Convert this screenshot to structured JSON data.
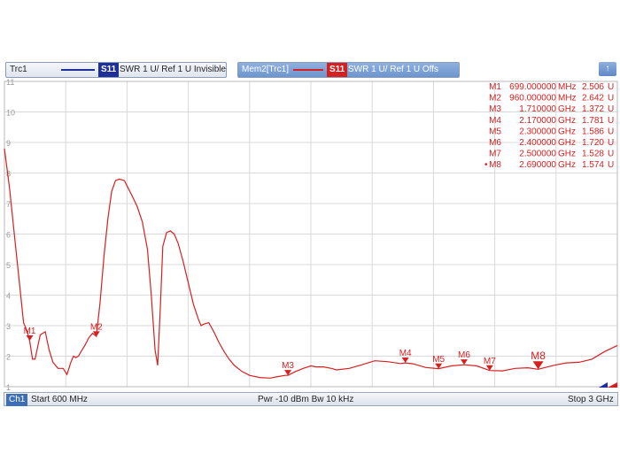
{
  "header": {
    "trace1": {
      "name": "Trc1",
      "param": "S11",
      "desc": "SWR  1 U/ Ref 1 U  Invisible",
      "color": "#1f2f9a"
    },
    "trace2": {
      "name": "Mem2[Trc1]",
      "param": "S11",
      "desc": "SWR  1 U/ Ref 1 U  Offs",
      "color": "#d62020"
    },
    "button_glyph": "↑"
  },
  "footer": {
    "channel": "Ch1",
    "start": "Start  600 MHz",
    "center": "Pwr  -10 dBm  Bw  10 kHz",
    "stop": "Stop  3 GHz"
  },
  "marker_table": [
    {
      "label": "M1",
      "freq": "699.000000",
      "unit": "MHz",
      "value": "2.506",
      "vunit": "U",
      "active": false
    },
    {
      "label": "M2",
      "freq": "960.000000",
      "unit": "MHz",
      "value": "2.642",
      "vunit": "U",
      "active": false
    },
    {
      "label": "M3",
      "freq": "1.710000",
      "unit": "GHz",
      "value": "1.372",
      "vunit": "U",
      "active": false
    },
    {
      "label": "M4",
      "freq": "2.170000",
      "unit": "GHz",
      "value": "1.781",
      "vunit": "U",
      "active": false
    },
    {
      "label": "M5",
      "freq": "2.300000",
      "unit": "GHz",
      "value": "1.586",
      "vunit": "U",
      "active": false
    },
    {
      "label": "M6",
      "freq": "2.400000",
      "unit": "GHz",
      "value": "1.720",
      "vunit": "U",
      "active": false
    },
    {
      "label": "M7",
      "freq": "2.500000",
      "unit": "GHz",
      "value": "1.528",
      "vunit": "U",
      "active": false
    },
    {
      "label": "M8",
      "freq": "2.690000",
      "unit": "GHz",
      "value": "1.574",
      "vunit": "U",
      "active": true
    }
  ],
  "chart_data": {
    "type": "line",
    "title": "",
    "xlabel": "",
    "ylabel": "",
    "xlim": [
      600,
      3000
    ],
    "ylim": [
      1,
      11
    ],
    "x_unit": "MHz",
    "grid": true,
    "y_ticks": [
      "11",
      "10",
      "9",
      "8",
      "7",
      "6",
      "5",
      "4",
      "3",
      "2",
      "1"
    ],
    "series": [
      {
        "color": "#d62020",
        "x": [
          600,
          620,
          640,
          660,
          675,
          690,
          699,
          710,
          720,
          740,
          760,
          775,
          790,
          810,
          830,
          845,
          860,
          870,
          880,
          890,
          900,
          915,
          930,
          945,
          960,
          975,
          990,
          1005,
          1020,
          1035,
          1050,
          1070,
          1085,
          1100,
          1120,
          1140,
          1160,
          1175,
          1190,
          1200,
          1210,
          1220,
          1235,
          1250,
          1265,
          1280,
          1300,
          1320,
          1340,
          1360,
          1370,
          1380,
          1400,
          1420,
          1440,
          1460,
          1480,
          1500,
          1530,
          1560,
          1600,
          1640,
          1670,
          1700,
          1710,
          1740,
          1770,
          1800,
          1820,
          1850,
          1880,
          1900,
          1950,
          2000,
          2050,
          2100,
          2150,
          2170,
          2200,
          2250,
          2300,
          2350,
          2400,
          2450,
          2500,
          2550,
          2600,
          2650,
          2690,
          2750,
          2800,
          2850,
          2900,
          2950,
          3000
        ],
        "y": [
          8.8,
          7.5,
          5.9,
          4.3,
          3.1,
          2.8,
          2.5,
          1.9,
          1.9,
          2.7,
          2.8,
          2.2,
          1.8,
          1.6,
          1.6,
          1.4,
          1.8,
          2.0,
          1.95,
          2.0,
          2.15,
          2.35,
          2.6,
          2.75,
          2.65,
          3.8,
          5.3,
          6.5,
          7.4,
          7.75,
          7.8,
          7.75,
          7.5,
          7.25,
          6.9,
          6.4,
          5.5,
          4.0,
          2.2,
          1.7,
          3.5,
          5.6,
          6.05,
          6.1,
          6.0,
          5.7,
          5.1,
          4.4,
          3.7,
          3.2,
          3.0,
          3.05,
          3.1,
          2.8,
          2.45,
          2.15,
          1.9,
          1.7,
          1.5,
          1.37,
          1.3,
          1.28,
          1.33,
          1.37,
          1.37,
          1.5,
          1.6,
          1.68,
          1.65,
          1.65,
          1.6,
          1.55,
          1.6,
          1.72,
          1.85,
          1.82,
          1.76,
          1.78,
          1.75,
          1.63,
          1.59,
          1.68,
          1.72,
          1.68,
          1.53,
          1.52,
          1.6,
          1.62,
          1.57,
          1.7,
          1.78,
          1.8,
          1.9,
          2.15,
          2.35
        ]
      }
    ],
    "markers": [
      {
        "label": "M1",
        "x": 699,
        "y": 2.506
      },
      {
        "label": "M2",
        "x": 960,
        "y": 2.642
      },
      {
        "label": "M3",
        "x": 1710,
        "y": 1.372
      },
      {
        "label": "M4",
        "x": 2170,
        "y": 1.781
      },
      {
        "label": "M5",
        "x": 2300,
        "y": 1.586
      },
      {
        "label": "M6",
        "x": 2400,
        "y": 1.72
      },
      {
        "label": "M7",
        "x": 2500,
        "y": 1.528
      },
      {
        "label": "M8",
        "x": 2690,
        "y": 1.574
      }
    ]
  }
}
